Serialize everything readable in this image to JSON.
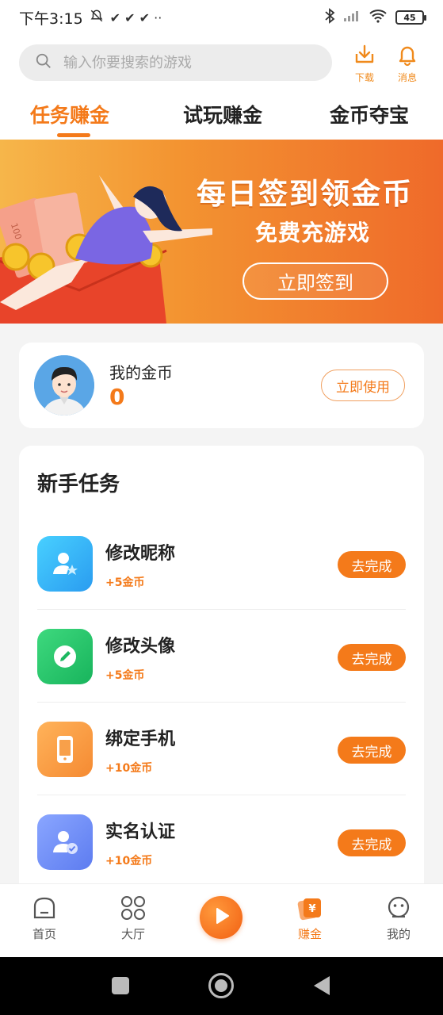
{
  "status_bar": {
    "time": "下午3:15",
    "extra": "✔ ✔ ✔ ··",
    "battery": "45"
  },
  "search": {
    "placeholder": "输入你要搜索的游戏"
  },
  "header_actions": {
    "download": "下载",
    "messages": "消息"
  },
  "tabs": [
    {
      "label": "任务赚金",
      "active": true
    },
    {
      "label": "试玩赚金",
      "active": false
    },
    {
      "label": "金币夺宝",
      "active": false
    }
  ],
  "banner": {
    "title": "每日签到领金币",
    "subtitle": "免费充游戏",
    "cta": "立即签到",
    "note_text": "100"
  },
  "coins": {
    "label": "我的金币",
    "value": "0",
    "use_button": "立即使用"
  },
  "tasks": {
    "heading": "新手任务",
    "items": [
      {
        "title": "修改昵称",
        "reward": "+5金币",
        "button": "去完成",
        "icon": "user-star-icon",
        "color": "#34b6f5"
      },
      {
        "title": "修改头像",
        "reward": "+5金币",
        "button": "去完成",
        "icon": "edit-icon",
        "color": "#22c36a"
      },
      {
        "title": "绑定手机",
        "reward": "+10金币",
        "button": "去完成",
        "icon": "phone-icon",
        "color": "#f7a24a"
      },
      {
        "title": "实名认证",
        "reward": "+10金币",
        "button": "去完成",
        "icon": "verified-user-icon",
        "color": "#6b8cf5"
      }
    ]
  },
  "bottom_nav": [
    {
      "label": "首页",
      "icon": "home-icon",
      "active": false
    },
    {
      "label": "大厅",
      "icon": "grid-icon",
      "active": false
    },
    {
      "label": "",
      "icon": "play-icon",
      "active": false
    },
    {
      "label": "赚金",
      "icon": "earn-icon",
      "active": true
    },
    {
      "label": "我的",
      "icon": "profile-icon",
      "active": false
    }
  ],
  "colors": {
    "accent": "#f47a1a",
    "background": "#f4f4f4"
  }
}
